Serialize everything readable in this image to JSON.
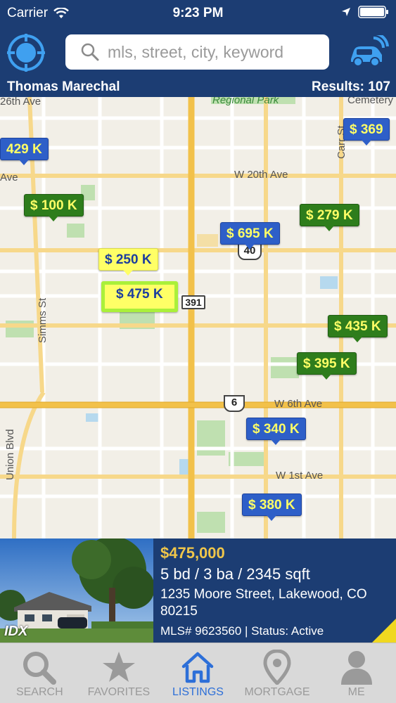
{
  "status_bar": {
    "carrier": "Carrier",
    "time": "9:23 PM"
  },
  "header": {
    "search_placeholder": "mls, street, city, keyword",
    "agent_name": "Thomas Marechal",
    "results": "Results: 107"
  },
  "map": {
    "streets": {
      "s1": "26th Ave",
      "s2": "Regional Park",
      "s3": "Cemetery",
      "s4": "W 20th Ave",
      "s5": "Ave",
      "s6": "Carr St",
      "s7": "Simms St",
      "s8": "W 6th Ave",
      "s9": "Union Blvd",
      "s10": "W 1st Ave"
    },
    "shields": {
      "h1": "40",
      "h2": "391",
      "h3": "6"
    },
    "pins": [
      {
        "label": "429 K",
        "color": "blue"
      },
      {
        "label": "$ 369",
        "color": "blue"
      },
      {
        "label": "$ 100 K",
        "color": "green"
      },
      {
        "label": "$ 279 K",
        "color": "green"
      },
      {
        "label": "$ 695 K",
        "color": "blue"
      },
      {
        "label": "$ 250 K",
        "color": "yellow"
      },
      {
        "label": "$ 475 K",
        "color": "selected"
      },
      {
        "label": "$ 435 K",
        "color": "green"
      },
      {
        "label": "$ 395 K",
        "color": "green"
      },
      {
        "label": "$ 340 K",
        "color": "blue"
      },
      {
        "label": "$ 380 K",
        "color": "blue"
      }
    ]
  },
  "listing": {
    "price": "$475,000",
    "specs": "5 bd / 3 ba / 2345 sqft",
    "address": "1235 Moore Street, Lakewood, CO 80215",
    "mls": "MLS# 9623560 | Status: Active",
    "badge": "IDX"
  },
  "tabs": [
    {
      "label": "SEARCH",
      "icon": "search-icon"
    },
    {
      "label": "FAVORITES",
      "icon": "star-icon"
    },
    {
      "label": "LISTINGS",
      "icon": "home-icon",
      "active": true
    },
    {
      "label": "MORTGAGE",
      "icon": "map-pin-icon"
    },
    {
      "label": "ME",
      "icon": "person-icon"
    }
  ],
  "colors": {
    "header_bg": "#1c3d73",
    "price": "#f0c64a",
    "active_tab": "#2d6fd8",
    "pin_blue": "#2e5fc8",
    "pin_green": "#2e7d1c",
    "pin_yellow": "#ffff66"
  }
}
